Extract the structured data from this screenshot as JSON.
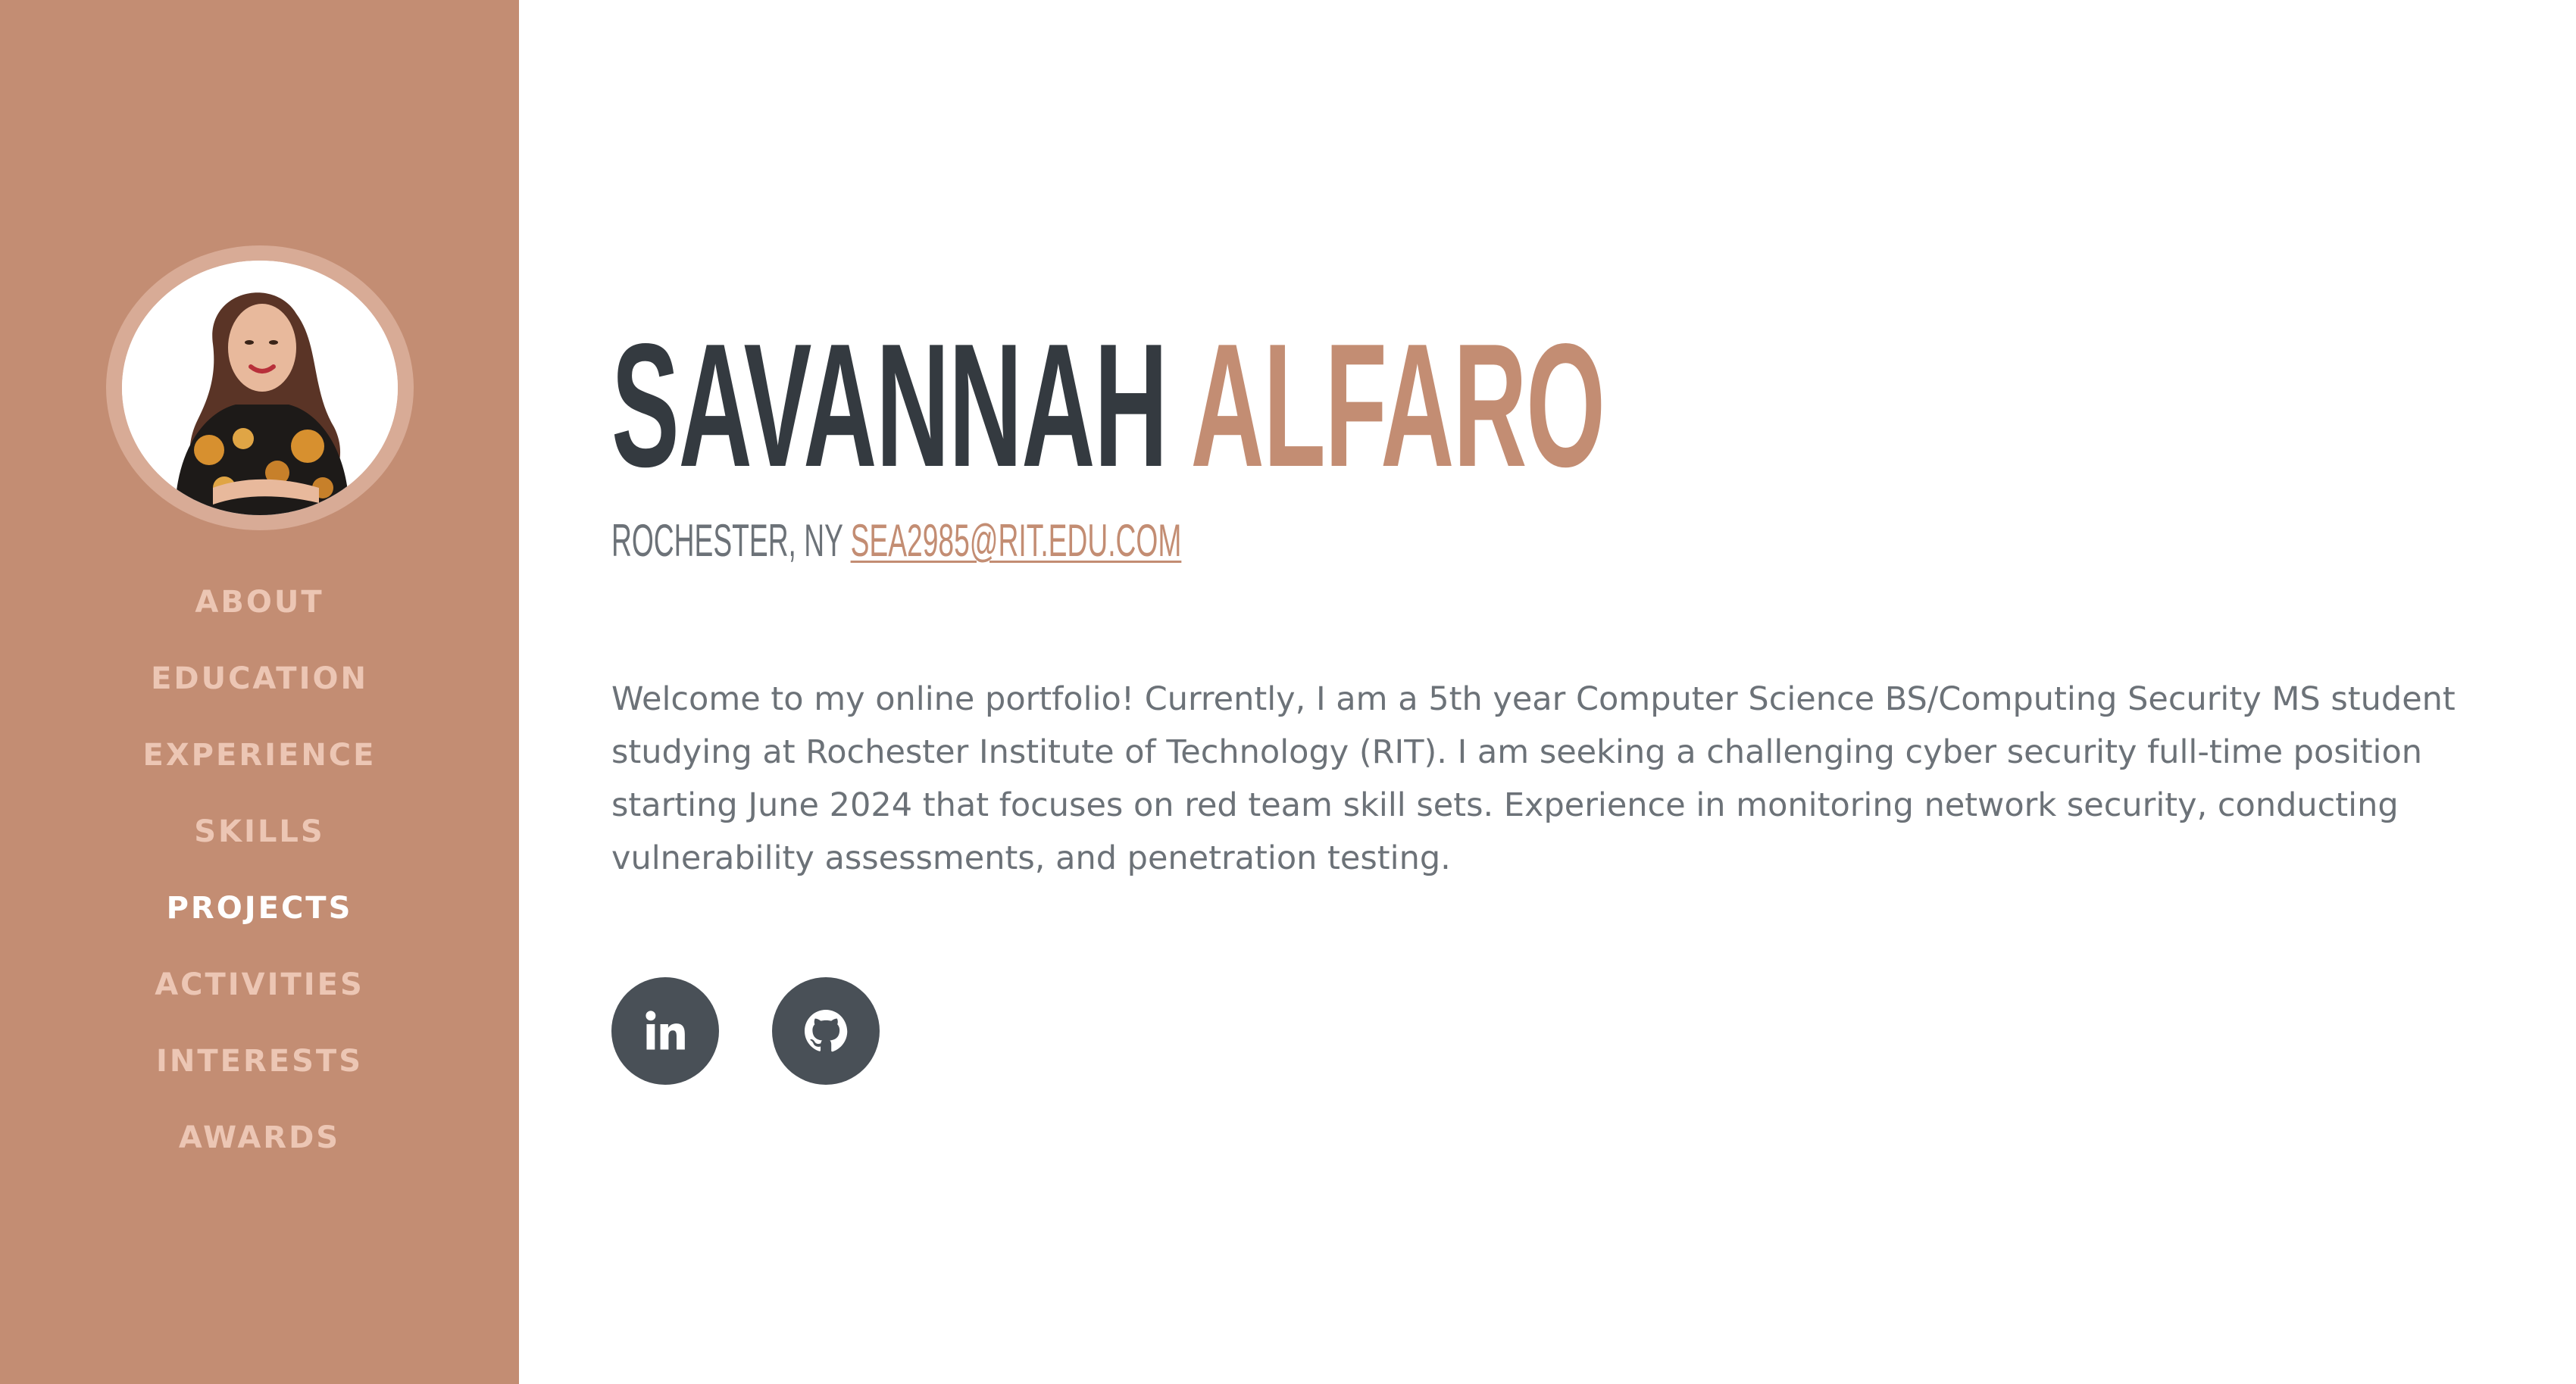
{
  "sidebar": {
    "nav": [
      {
        "label": "ABOUT"
      },
      {
        "label": "EDUCATION"
      },
      {
        "label": "EXPERIENCE"
      },
      {
        "label": "SKILLS"
      },
      {
        "label": "PROJECTS"
      },
      {
        "label": "ACTIVITIES"
      },
      {
        "label": "INTERESTS"
      },
      {
        "label": "AWARDS"
      }
    ],
    "active_item": "PROJECTS"
  },
  "header": {
    "first_name": "SAVANNAH",
    "last_name": "ALFARO",
    "location": "ROCHESTER, NY",
    "email": "SEA2985@RIT.EDU.COM"
  },
  "about": {
    "bio": "Welcome to my online portfolio! Currently, I am a 5th year Computer Science BS/Computing Security MS student studying at Rochester Institute of Technology (RIT). I am seeking a challenging cyber security full-time position starting June 2024 that focuses on red team skill sets. Experience in monitoring network security, conducting vulnerability assessments, and penetration testing."
  },
  "social": [
    {
      "icon": "linkedin-icon"
    },
    {
      "icon": "github-icon"
    }
  ],
  "colors": {
    "accent": "#c38d73",
    "sidebar_bg": "#c38d73",
    "nav_text": "#ecc6b4",
    "nav_active": "#ffffff",
    "heading_dark": "#343a40",
    "body_text": "#6c7278",
    "social_bg": "#495057"
  }
}
